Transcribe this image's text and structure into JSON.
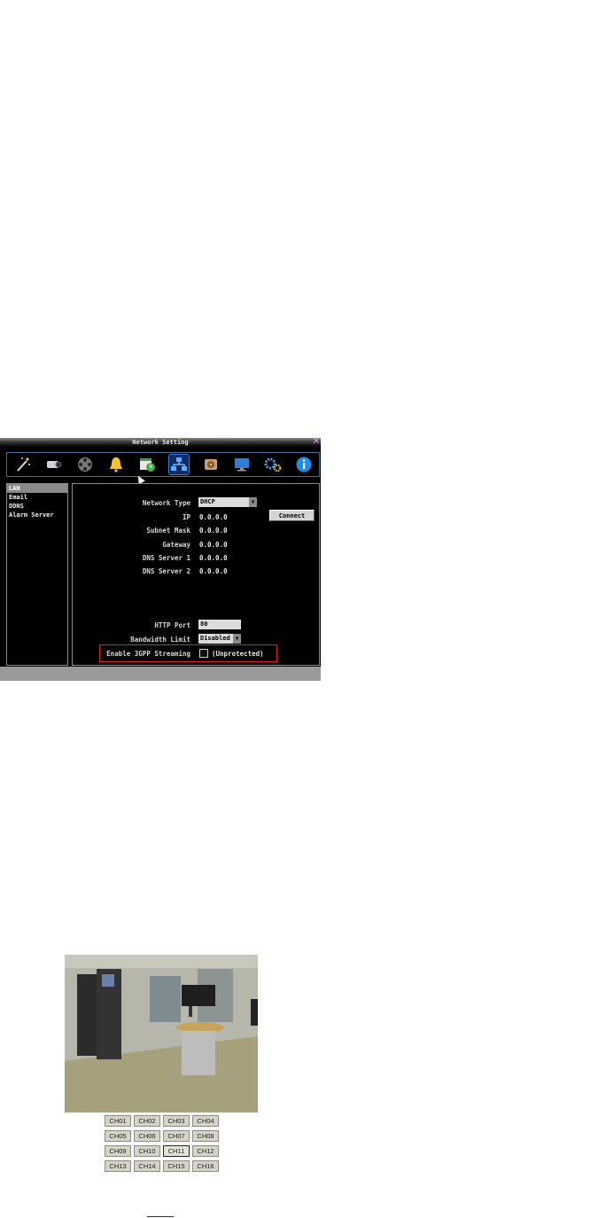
{
  "window": {
    "title": "Network Setting",
    "close_glyph": "✕"
  },
  "toolbar": {
    "icons": [
      "wizard-icon",
      "camera-icon",
      "record-icon",
      "alarm-bell-icon",
      "schedule-icon",
      "network-icon",
      "disk-icon",
      "monitor-icon",
      "system-gear-icon",
      "info-icon"
    ],
    "selected": "network-icon"
  },
  "sidebar": {
    "items": [
      "LAN",
      "Email",
      "DDNS",
      "Alarm Server"
    ],
    "selected": "LAN"
  },
  "form": {
    "network_type": {
      "label": "Network Type",
      "value": "DHCP"
    },
    "ip": {
      "label": "IP",
      "value": "0.0.0.0"
    },
    "subnet": {
      "label": "Subnet Mask",
      "value": "0.0.0.0"
    },
    "gateway": {
      "label": "Gateway",
      "value": "0.0.0.0"
    },
    "dns1": {
      "label": "DNS Server 1",
      "value": "0.0.0.0"
    },
    "dns2": {
      "label": "DNS Server 2",
      "value": "0.0.0.0"
    },
    "http_port": {
      "label": "HTTP Port",
      "value": "80"
    },
    "bandwidth": {
      "label": "Bandwidth Limit",
      "value": "Disabled"
    },
    "streaming": {
      "label": "Enable 3GPP Streaming",
      "suffix": "(Unprotected)",
      "checked": false
    },
    "connect_label": "Connect"
  },
  "viewer": {
    "channels": [
      "CH01",
      "CH02",
      "CH03",
      "CH04",
      "CH05",
      "CH06",
      "CH07",
      "CH08",
      "CH09",
      "CH10",
      "CH11",
      "CH12",
      "CH13",
      "CH14",
      "CH15",
      "CH16"
    ],
    "selected": "CH11"
  },
  "colors": {
    "highlight_box": "#e0262a",
    "selected_tab": "#0b2a66"
  }
}
